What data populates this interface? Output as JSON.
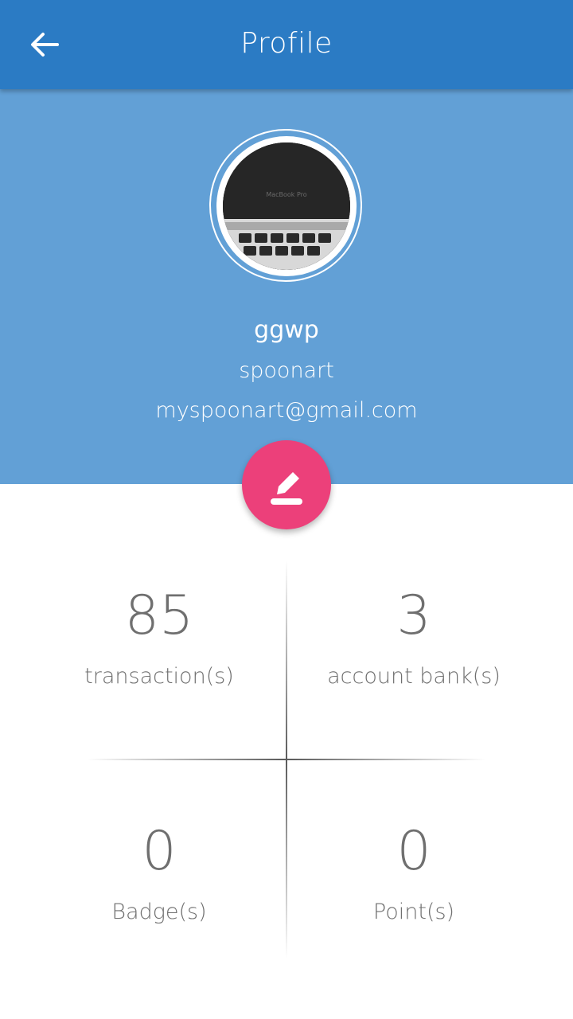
{
  "appbar": {
    "title": "Profile",
    "back_icon": "arrow-back-icon"
  },
  "profile": {
    "name": "ggwp",
    "username": "spoonart",
    "email": "myspoonart@gmail.com",
    "avatar_desc": "laptop photo",
    "avatar_brand_text": "MacBook Pro"
  },
  "fab": {
    "icon": "edit-pencil-icon",
    "color": "#ec407a"
  },
  "stats": [
    {
      "value": "85",
      "label": "transaction(s)"
    },
    {
      "value": "3",
      "label": "account bank(s)"
    },
    {
      "value": "0",
      "label": "Badge(s)"
    },
    {
      "value": "0",
      "label": "Point(s)"
    }
  ],
  "colors": {
    "appbar": "#2b7bc4",
    "header": "#62a0d6",
    "text_stats": "#6f6f6f"
  }
}
